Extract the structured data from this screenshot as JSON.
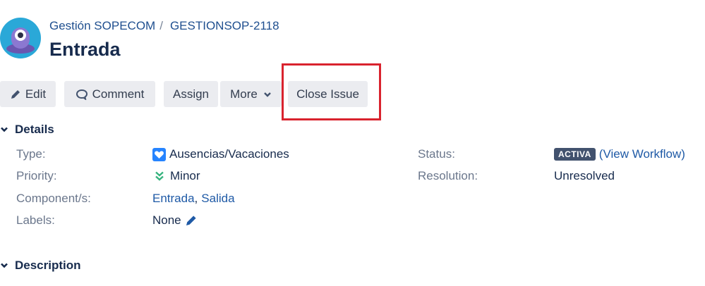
{
  "header": {
    "project": "Gestión SOPECOM",
    "separator": "/",
    "issue_key": "GESTIONSOP-2118",
    "title": "Entrada"
  },
  "toolbar": {
    "edit": "Edit",
    "comment": "Comment",
    "assign": "Assign",
    "more": "More",
    "close_issue": "Close Issue"
  },
  "details": {
    "heading": "Details",
    "type_label": "Type:",
    "type_value": "Ausencias/Vacaciones",
    "priority_label": "Priority:",
    "priority_value": "Minor",
    "components_label": "Component/s:",
    "component_1": "Entrada",
    "component_sep": ",",
    "component_2": "Salida",
    "labels_label": "Labels:",
    "labels_value": "None",
    "status_label": "Status:",
    "status_badge": "ACTIVA",
    "status_link": "(View Workflow)",
    "resolution_label": "Resolution:",
    "resolution_value": "Unresolved"
  },
  "description": {
    "heading": "Description"
  },
  "colors": {
    "accent_link": "#1f5aa6",
    "highlight_box": "#d9232e",
    "status_badge_bg": "#42526e",
    "type_icon": "#2684ff",
    "priority_icon": "#36b37e"
  },
  "icons": [
    "project-avatar-icon",
    "pencil-icon",
    "comment-icon",
    "chevron-down-icon",
    "heart-icon",
    "double-chevron-down-icon",
    "edit-pencil-icon"
  ]
}
